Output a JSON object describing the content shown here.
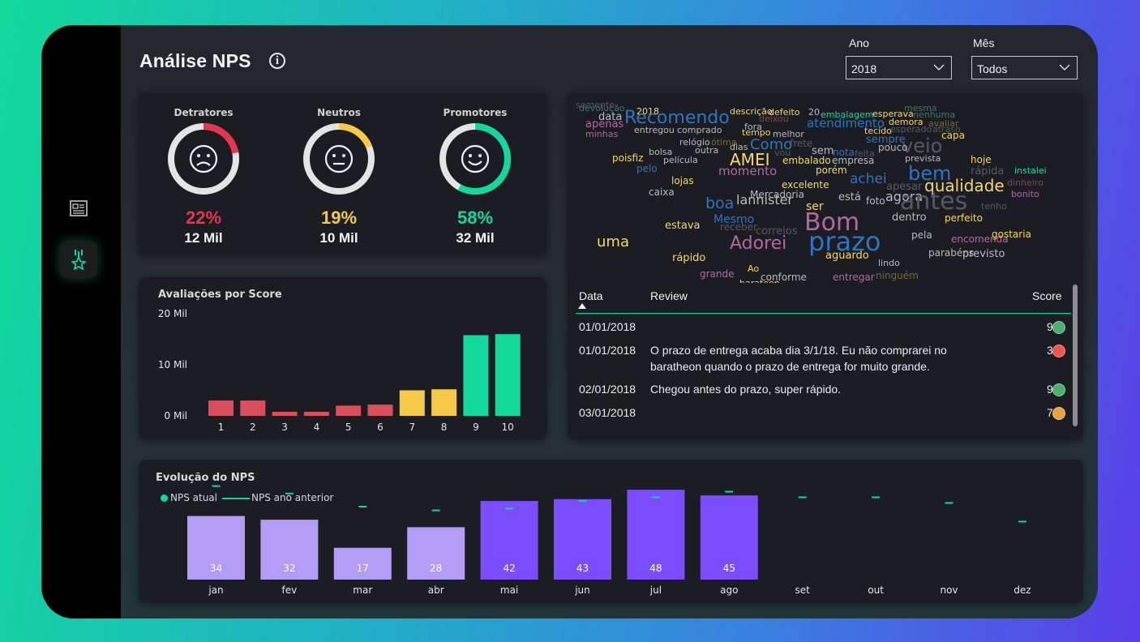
{
  "page": {
    "title": "Análise NPS",
    "sidebar": [
      {
        "icon": "report-icon",
        "active": false
      },
      {
        "icon": "award-star-icon",
        "active": true
      }
    ]
  },
  "filters": {
    "ano_label": "Ano",
    "ano_value": "2018",
    "mes_label": "Mês",
    "mes_value": "Todos"
  },
  "nps": [
    {
      "label": "Detratores",
      "pct": "22%",
      "count": "12 Mil",
      "fraction": 0.22,
      "color": "#e8344f",
      "face": "sad"
    },
    {
      "label": "Neutros",
      "pct": "19%",
      "count": "10 Mil",
      "fraction": 0.19,
      "color": "#f7c948",
      "face": "neutral"
    },
    {
      "label": "Promotores",
      "pct": "58%",
      "count": "32 Mil",
      "fraction": 0.58,
      "color": "#12d99a",
      "face": "happy"
    }
  ],
  "colors": {
    "detractor": "#d9505c",
    "neutral": "#f7c948",
    "promoter": "#12d99a",
    "nps_current_dark": "#7c4dff",
    "nps_current_light": "#b39cf5",
    "nps_previous": "#12d99a"
  },
  "wordcloud": {
    "words": [
      {
        "t": "devolução",
        "c": "#3a7a6a"
      },
      {
        "t": "2018",
        "c": "#f5d76e"
      },
      {
        "t": "data",
        "c": "#bbbbbb"
      },
      {
        "t": "apenas",
        "c": "#b06aa0"
      },
      {
        "t": "Recomendo",
        "c": "#2f74c0"
      },
      {
        "t": "descrição",
        "c": "#f5d76e"
      },
      {
        "t": "defeito",
        "c": "#f5d76e"
      },
      {
        "t": "20",
        "c": "#bbbbbb"
      },
      {
        "t": "embalagem",
        "c": "#12d99a"
      },
      {
        "t": "esperava",
        "c": "#f5d76e"
      },
      {
        "t": "mesma",
        "c": "#3a7a6a"
      },
      {
        "t": "nenhuma",
        "c": "#3a7a6a"
      },
      {
        "t": "minhas",
        "c": "#b06aa0"
      },
      {
        "t": "entregou",
        "c": "#bbbbbb"
      },
      {
        "t": "comprado",
        "c": "#bbbbbb"
      },
      {
        "t": "fora",
        "c": "#bbbbbb"
      },
      {
        "t": "deixou",
        "c": "#7a4a4a"
      },
      {
        "t": "atendimento",
        "c": "#2f74c0"
      },
      {
        "t": "tecido",
        "c": "#f5d76e"
      },
      {
        "t": "demora",
        "c": "#f5d76e"
      },
      {
        "t": "avaliar",
        "c": "#7a6a3a"
      },
      {
        "t": "esperado",
        "c": "#555a5e"
      },
      {
        "t": "atraso",
        "c": "#555a5e"
      },
      {
        "t": "poisfiz",
        "c": "#f5d76e"
      },
      {
        "t": "relógio",
        "c": "#bbbbbb"
      },
      {
        "t": "ótima",
        "c": "#7a6a3a"
      },
      {
        "t": "tempo",
        "c": "#f5d76e"
      },
      {
        "t": "melhor",
        "c": "#bbbbbb"
      },
      {
        "t": "Como",
        "c": "#2f74c0"
      },
      {
        "t": "frete",
        "c": "#555a5e"
      },
      {
        "t": "sempre",
        "c": "#2f74c0"
      },
      {
        "t": "capa",
        "c": "#f5d76e"
      },
      {
        "t": "veio",
        "c": "#555a5e"
      },
      {
        "t": "AMEI",
        "c": "#f5d76e"
      },
      {
        "t": "bolsa",
        "c": "#bbbbbb"
      },
      {
        "t": "película",
        "c": "#bbbbbb"
      },
      {
        "t": "outra",
        "c": "#bbbbbb"
      },
      {
        "t": "dias",
        "c": "#bbbbbb"
      },
      {
        "t": "vou",
        "c": "#555a5e"
      },
      {
        "t": "sem",
        "c": "#bbbbbb"
      },
      {
        "t": "nota",
        "c": "#2f74c0"
      },
      {
        "t": "feita",
        "c": "#555a5e"
      },
      {
        "t": "pouco",
        "c": "#bbbbbb"
      },
      {
        "t": "prevista",
        "c": "#bbbbbb"
      },
      {
        "t": "hoje",
        "c": "#f5d76e"
      },
      {
        "t": "pelo",
        "c": "#2f74c0"
      },
      {
        "t": "momento",
        "c": "#b06aa0"
      },
      {
        "t": "embalado",
        "c": "#f5d76e"
      },
      {
        "t": "porém",
        "c": "#f5d76e"
      },
      {
        "t": "empresa",
        "c": "#bbbbbb"
      },
      {
        "t": "bem",
        "c": "#2f74c0"
      },
      {
        "t": "rápida",
        "c": "#555a5e"
      },
      {
        "t": "instalei",
        "c": "#12d99a"
      },
      {
        "t": "lojas",
        "c": "#f5d76e"
      },
      {
        "t": "excelente",
        "c": "#f5d76e"
      },
      {
        "t": "achei",
        "c": "#2f74c0"
      },
      {
        "t": "apesar",
        "c": "#555a5e"
      },
      {
        "t": "dinheiro",
        "c": "#7a4a4a"
      },
      {
        "t": "qualidade",
        "c": "#f5d76e"
      },
      {
        "t": "agora",
        "c": "#bbbbbb"
      },
      {
        "t": "antes",
        "c": "#555a5e"
      },
      {
        "t": "caixa",
        "c": "#bbbbbb"
      },
      {
        "t": "lannister",
        "c": "#bbbbbb"
      },
      {
        "t": "ser",
        "c": "#f5d76e"
      },
      {
        "t": "boa",
        "c": "#2f74c0"
      },
      {
        "t": "Mercadoria",
        "c": "#bbbbbb"
      },
      {
        "t": "está",
        "c": "#bbbbbb"
      },
      {
        "t": "foto",
        "c": "#bbbbbb"
      },
      {
        "t": "bonito",
        "c": "#b06aa0"
      },
      {
        "t": "Bom",
        "c": "#b06aa0"
      },
      {
        "t": "prazo",
        "c": "#2f74c0"
      },
      {
        "t": "dentro",
        "c": "#bbbbbb"
      },
      {
        "t": "perfeito",
        "c": "#f5d76e"
      },
      {
        "t": "tenho",
        "c": "#555a5e"
      },
      {
        "t": "uma",
        "c": "#f5d76e"
      },
      {
        "t": "Adorei",
        "c": "#b06aa0"
      },
      {
        "t": "Mesmo",
        "c": "#2f74c0"
      },
      {
        "t": "estava",
        "c": "#f5d76e"
      },
      {
        "t": "receber",
        "c": "#555a5e"
      },
      {
        "t": "correios",
        "c": "#555a5e"
      },
      {
        "t": "pela",
        "c": "#bbbbbb"
      },
      {
        "t": "encomenda",
        "c": "#b06aa0"
      },
      {
        "t": "gostaria",
        "c": "#f5d76e"
      },
      {
        "t": "rápido",
        "c": "#f5d76e"
      },
      {
        "t": "aguardo",
        "c": "#f5d76e"
      },
      {
        "t": "parabéns",
        "c": "#bbbbbb"
      },
      {
        "t": "lindo",
        "c": "#bbbbbb"
      },
      {
        "t": "previsto",
        "c": "#bbbbbb"
      },
      {
        "t": "Ao",
        "c": "#f5d76e"
      },
      {
        "t": "conforme",
        "c": "#bbbbbb"
      },
      {
        "t": "entregar",
        "c": "#b06aa0"
      },
      {
        "t": "ninguém",
        "c": "#7a6a3a"
      },
      {
        "t": "grande",
        "c": "#b06aa0"
      },
      {
        "t": "barateon",
        "c": "#f5d76e"
      },
      {
        "t": "somente",
        "c": "#555a5e"
      }
    ]
  },
  "reviews": {
    "headers": {
      "data": "Data",
      "review": "Review",
      "score": "Score"
    },
    "rows": [
      {
        "date": "01/01/2018",
        "review": "",
        "score": "9",
        "color": "#4caf70"
      },
      {
        "date": "01/01/2018",
        "review": "O prazo de entrega acaba dia 3/1/18. Eu não comprarei no baratheon quando o prazo de entrega for muito grande.",
        "score": "3",
        "color": "#f0544f"
      },
      {
        "date": "02/01/2018",
        "review": "Chegou antes do prazo, super rápido.",
        "score": "9",
        "color": "#4caf70"
      },
      {
        "date": "03/01/2018",
        "review": "",
        "score": "7",
        "color": "#e8a33a"
      }
    ]
  },
  "score_chart": {
    "title": "Avaliações por Score",
    "chart_data": {
      "type": "bar",
      "categories": [
        "1",
        "2",
        "3",
        "4",
        "5",
        "6",
        "7",
        "8",
        "9",
        "10"
      ],
      "values": [
        3.0,
        3.0,
        0.8,
        0.8,
        2.0,
        2.2,
        5.0,
        5.2,
        15.8,
        16.0
      ],
      "value_unit": "Mil",
      "bar_colors": [
        "#d9505c",
        "#d9505c",
        "#d9505c",
        "#d9505c",
        "#d9505c",
        "#d9505c",
        "#f7c948",
        "#f7c948",
        "#12d99a",
        "#12d99a"
      ],
      "yticks": [
        "0 Mil",
        "10 Mil",
        "20 Mil"
      ],
      "ylim": [
        0,
        20
      ]
    }
  },
  "evolution_chart": {
    "title": "Evolução do NPS",
    "legend": [
      {
        "name": "NPS atual",
        "color": "#12d99a",
        "marker": "dot"
      },
      {
        "name": "NPS ano anterior",
        "color": "#12d99a",
        "marker": "line"
      }
    ],
    "chart_data": {
      "type": "bar",
      "categories": [
        "jan",
        "fev",
        "mar",
        "abr",
        "mai",
        "jun",
        "jul",
        "ago",
        "set",
        "out",
        "nov",
        "dez"
      ],
      "series": [
        {
          "name": "NPS atual",
          "values": [
            34,
            32,
            17,
            28,
            42,
            43,
            48,
            45,
            null,
            null,
            null,
            null
          ]
        },
        {
          "name": "NPS ano anterior",
          "values": [
            50,
            46,
            39,
            37,
            38,
            42,
            44,
            47,
            44,
            44,
            41,
            31
          ]
        }
      ],
      "ylim": [
        0,
        52
      ]
    }
  }
}
